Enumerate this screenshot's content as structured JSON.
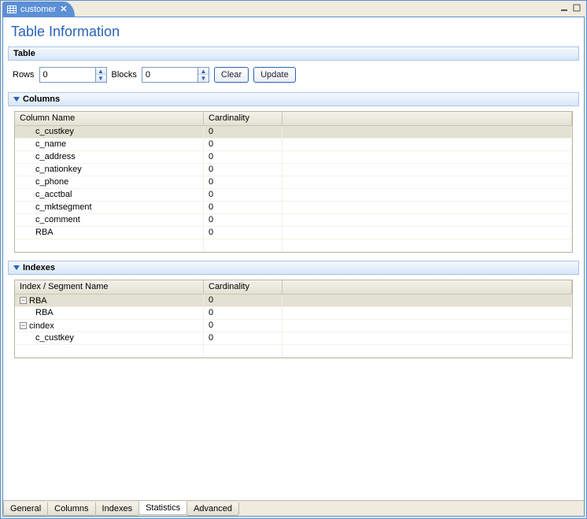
{
  "window": {
    "tab_title": "customer",
    "minimize_tooltip": "Minimize",
    "maximize_tooltip": "Maximize"
  },
  "page_title": "Table Information",
  "sections": {
    "table": "Table",
    "columns": "Columns",
    "indexes": "Indexes"
  },
  "form": {
    "rows_label": "Rows",
    "rows_value": "0",
    "blocks_label": "Blocks",
    "blocks_value": "0",
    "clear_label": "Clear",
    "update_label": "Update"
  },
  "columns_grid": {
    "headers": {
      "name": "Column Name",
      "card": "Cardinality"
    },
    "rows": [
      {
        "name": "c_custkey",
        "card": "0"
      },
      {
        "name": "c_name",
        "card": "0"
      },
      {
        "name": "c_address",
        "card": "0"
      },
      {
        "name": "c_nationkey",
        "card": "0"
      },
      {
        "name": "c_phone",
        "card": "0"
      },
      {
        "name": "c_acctbal",
        "card": "0"
      },
      {
        "name": "c_mktsegment",
        "card": "0"
      },
      {
        "name": "c_comment",
        "card": "0"
      },
      {
        "name": "RBA",
        "card": "0"
      }
    ]
  },
  "indexes_grid": {
    "headers": {
      "name": "Index / Segment Name",
      "card": "Cardinality"
    },
    "rows": [
      {
        "name": "RBA",
        "card": "0",
        "level": 0,
        "icon": "minus"
      },
      {
        "name": "RBA",
        "card": "0",
        "level": 1
      },
      {
        "name": "cindex",
        "card": "0",
        "level": 0,
        "icon": "minus"
      },
      {
        "name": "c_custkey",
        "card": "0",
        "level": 1
      }
    ]
  },
  "bottom_tabs": {
    "items": [
      "General",
      "Columns",
      "Indexes",
      "Statistics",
      "Advanced"
    ],
    "active": 3
  }
}
